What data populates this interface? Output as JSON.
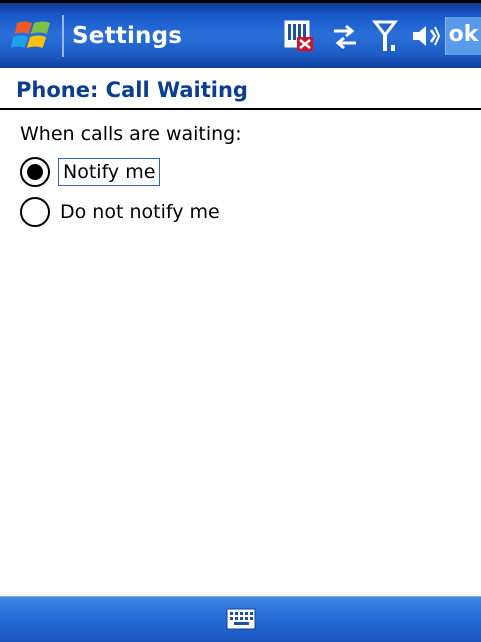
{
  "titlebar": {
    "title": "Settings",
    "ok_label": "ok",
    "icons": [
      "windows-start-icon",
      "sim-card-missing-icon",
      "connectivity-icon",
      "signal-antenna-icon",
      "speaker-volume-icon"
    ]
  },
  "page": {
    "heading": "Phone: Call Waiting"
  },
  "call_waiting": {
    "prompt": "When calls are waiting:",
    "options": [
      {
        "label": "Notify me",
        "selected": true
      },
      {
        "label": "Do not notify me",
        "selected": false
      }
    ]
  },
  "menubar": {
    "icon": "keyboard-icon"
  },
  "colors": {
    "title_bar": "#2a6fd9",
    "heading_text": "#0b3d91",
    "ok_button": "#5a9aea"
  }
}
